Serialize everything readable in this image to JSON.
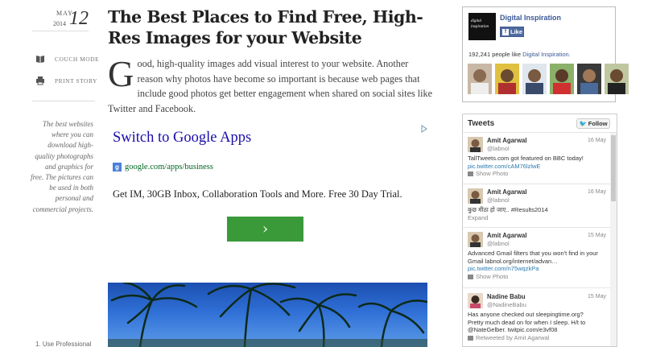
{
  "post": {
    "month": "MAY",
    "year": "2014",
    "day": "12",
    "title": "The Best Places to Find Free, High-Res Images for your Website",
    "lead_first_letter": "G",
    "lead_rest": "ood, high-quality images add visual interest to your website. Another reason why photos have become so important is because web pages that include good photos get better engagement when shared on social sites like Twitter and Facebook."
  },
  "left": {
    "couch_mode": "COUCH MODE",
    "print_story": "PRINT STORY",
    "blurb": "The best websites where you can download high-quality photographs and graphics for free. The pictures can be used in both personal and commercial projects.",
    "toc_item": "1. Use Professional"
  },
  "ad": {
    "headline": "Switch to Google Apps",
    "url": "google.com/apps/business",
    "g_icon": "g",
    "description": "Get IM, 30GB Inbox, Collaboration Tools and More. Free 30 Day Trial.",
    "button_glyph": "›",
    "button_color": "#3a9a3a"
  },
  "facebook": {
    "logo_text": "digital inspiration",
    "page_name": "Digital Inspiration",
    "like_label": "Like",
    "count_prefix": "192,241 people like ",
    "count_link": "Digital Inspiration.",
    "brand_color": "#3b5998"
  },
  "twitter": {
    "header": "Tweets",
    "follow_label": "Follow",
    "accent": "#55acee",
    "tweets": [
      {
        "name": "Amit Agarwal",
        "handle": "@labnol",
        "date": "16 May",
        "lines": [
          "TallTweets.com got featured on BBC today!",
          "pic.twitter.com/cAM76lzlwE"
        ],
        "action": "Show Photo"
      },
      {
        "name": "Amit Agarwal",
        "handle": "@labnol",
        "date": "16 May",
        "lines": [
          "कुछ मीठा हो जाए.. #Results2014"
        ],
        "action": "Expand"
      },
      {
        "name": "Amit Agarwal",
        "handle": "@labnol",
        "date": "15 May",
        "lines": [
          "Advanced Gmail filters that you won't find in your",
          "Gmail labnol.org/internet/advan…",
          "pic.twitter.com/n75wqzkPa"
        ],
        "action": "Show Photo"
      },
      {
        "name": "Nadine Babu",
        "handle": "@NadineBabu",
        "date": "15 May",
        "lines": [
          "Has anyone checked out sleepingtime.org?",
          "Pretty much dead on for when I sleep. H/t to",
          "@NateGelber. twitpic.com/e3vf08"
        ],
        "action": "Retweeted by Amit Agarwal"
      }
    ]
  }
}
